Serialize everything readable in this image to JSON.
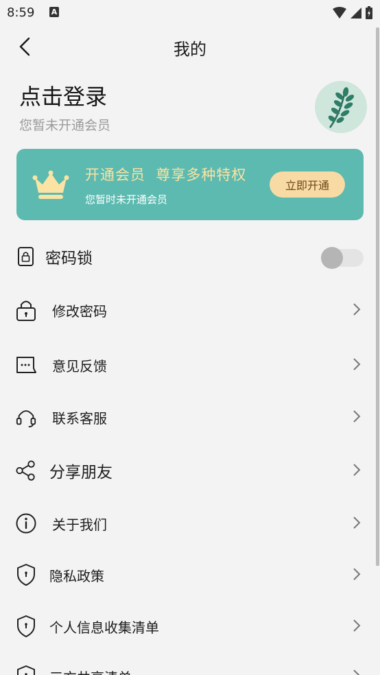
{
  "status_bar": {
    "time": "8:59",
    "a_icon": "A"
  },
  "header": {
    "title": "我的"
  },
  "profile": {
    "login_text": "点击登录",
    "member_status": "您暂未开通会员"
  },
  "vip_card": {
    "headline": "开通会员  尊享多种特权",
    "subtext": "您暂时未开通会员",
    "button_label": "立即开通"
  },
  "settings": {
    "password_lock": {
      "label": "密码锁",
      "enabled": false
    },
    "items": [
      {
        "label": "修改密码",
        "icon": "lock-icon"
      },
      {
        "label": "意见反馈",
        "icon": "message-icon"
      },
      {
        "label": "联系客服",
        "icon": "headset-icon"
      },
      {
        "label": "分享朋友",
        "icon": "share-icon"
      },
      {
        "label": "关于我们",
        "icon": "info-icon"
      },
      {
        "label": "隐私政策",
        "icon": "shield-icon"
      },
      {
        "label": "个人信息收集清单",
        "icon": "shield-icon"
      },
      {
        "label": "三方共享清单",
        "icon": "shield-icon"
      }
    ]
  },
  "colors": {
    "accent": "#5cbab0",
    "vip_button": "#f8dba4",
    "vip_gold_text": "#fbe3a4",
    "background": "#f3f3f3"
  }
}
